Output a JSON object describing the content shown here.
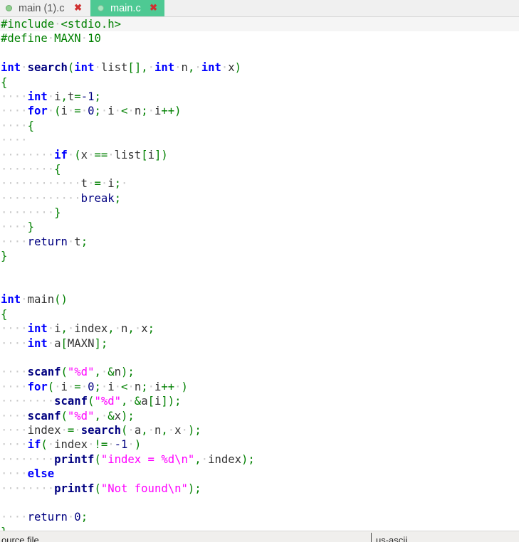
{
  "tabs": [
    {
      "label": "main (1).c",
      "active": false,
      "close_icon": "close-x-icon"
    },
    {
      "label": "main.c",
      "active": true,
      "close_icon": "close-x-icon"
    }
  ],
  "colors": {
    "active_tab": "#4ec993",
    "keyword": "#0000ff",
    "function": "#000080",
    "string": "#ff00ff",
    "punctuation": "#008000",
    "preprocessor": "#008000",
    "whitespace_marker": "#c8c8c8"
  },
  "editor": {
    "current_line": 1,
    "lines": [
      "#include <stdio.h>",
      "#define MAXN 10",
      "",
      "int search(int list[], int n, int x)",
      "{",
      "    int i,t=-1;",
      "    for (i = 0; i < n; i++)",
      "    {",
      "    ",
      "        if (x == list[i])",
      "        {",
      "            t = i; ",
      "            break;",
      "        }",
      "    }",
      "    return t;",
      "}",
      "",
      "",
      "int main()",
      "{",
      "    int i, index, n, x;",
      "    int a[MAXN];",
      "",
      "    scanf(\"%d\", &n);",
      "    for( i = 0; i < n; i++ )",
      "        scanf(\"%d\", &a[i]);",
      "    scanf(\"%d\", &x);",
      "    index = search( a, n, x );",
      "    if( index != -1 )",
      "        printf(\"index = %d\\n\", index);",
      "    else",
      "        printf(\"Not found\\n\");",
      "",
      "    return 0;",
      "}"
    ]
  },
  "status": {
    "left": "ource file",
    "right": "us-ascii"
  }
}
